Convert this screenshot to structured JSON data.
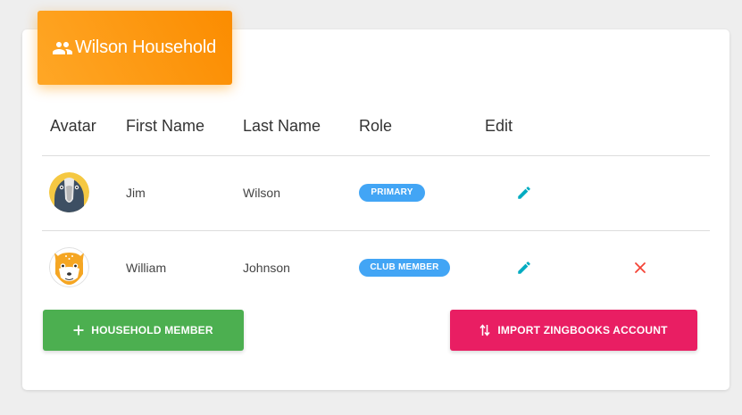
{
  "household": {
    "title": "Wilson Household",
    "header_icon": "people-icon",
    "header_color": "#fb8c00"
  },
  "table": {
    "columns": [
      "Avatar",
      "First Name",
      "Last Name",
      "Role",
      "Edit"
    ],
    "rows": [
      {
        "avatar": "shoebill-bird-avatar",
        "first_name": "Jim",
        "last_name": "Wilson",
        "role": "PRIMARY",
        "can_remove": false
      },
      {
        "avatar": "fox-avatar",
        "first_name": "William",
        "last_name": "Johnson",
        "role": "CLUB MEMBER",
        "can_remove": true
      }
    ]
  },
  "icons": {
    "edit": "pencil-icon",
    "remove": "close-icon",
    "add": "plus-icon",
    "import": "swap-vertical-icon"
  },
  "actions": {
    "add_member_label": "HOUSEHOLD MEMBER",
    "add_member_color": "#4caf50",
    "import_label": "IMPORT ZINGBOOKS ACCOUNT",
    "import_color": "#e91e63"
  },
  "colors": {
    "badge": "#42a5f5",
    "edit_icon": "#00acc1",
    "remove_icon": "#f44336"
  }
}
